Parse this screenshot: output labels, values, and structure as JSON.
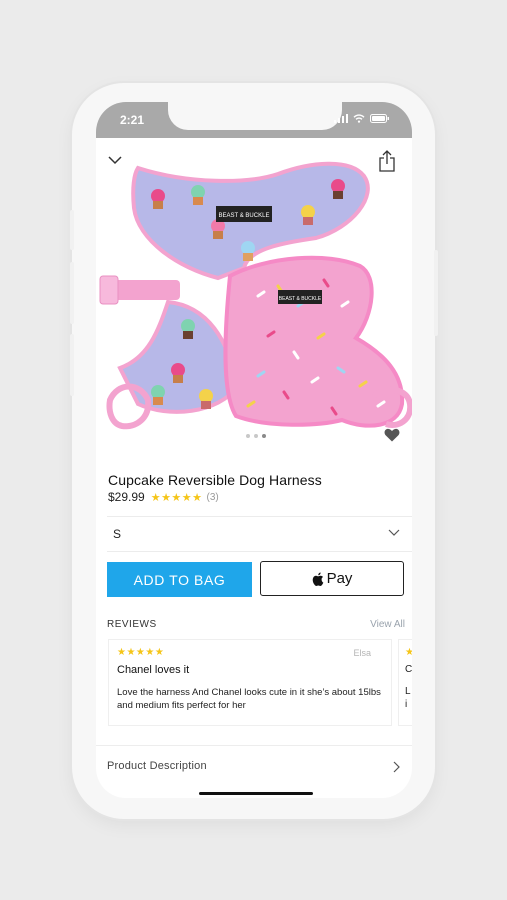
{
  "status_bar": {
    "time": "2:21"
  },
  "product": {
    "title": "Cupcake Reversible Dog Harness",
    "price": "$29.99",
    "rating_stars": "★★★★★",
    "review_count": "(3)",
    "image_brand_label": "BEAST & BUCKLE"
  },
  "size": {
    "selected": "S"
  },
  "actions": {
    "add_to_bag": "ADD TO BAG",
    "apple_pay": "Pay"
  },
  "reviews": {
    "title": "REVIEWS",
    "view_all": "View All",
    "items": [
      {
        "stars": "★★★★★",
        "author": "Elsa",
        "title": "Chanel loves it",
        "body": "Love the harness And Chanel looks cute in it she’s about 15lbs and medium fits perfect for her"
      },
      {
        "stars": "★",
        "title_start": "C",
        "body_start_1": "L",
        "body_start_2": "i"
      }
    ]
  },
  "description": {
    "label": "Product Description"
  },
  "colors": {
    "accent": "#1fa6ea",
    "star": "#f5c518",
    "harness_pink": "#f3a3cf",
    "harness_lilac": "#b7b8e8"
  }
}
